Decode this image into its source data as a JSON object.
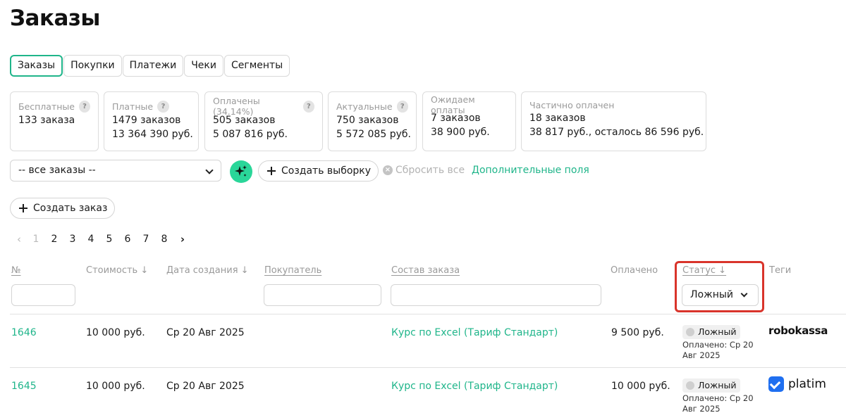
{
  "page": {
    "title": "Заказы"
  },
  "tabs": [
    {
      "label": "Заказы",
      "active": true
    },
    {
      "label": "Покупки"
    },
    {
      "label": "Платежи"
    },
    {
      "label": "Чеки"
    },
    {
      "label": "Сегменты"
    }
  ],
  "stats": [
    {
      "label": "Бесплатные",
      "help": "?",
      "line1": "133 заказа",
      "line2": ""
    },
    {
      "label": "Платные",
      "help": "?",
      "line1": "1479 заказов",
      "line2": "13 364 390 руб."
    },
    {
      "label": "Оплачены (34.14%)",
      "help": "?",
      "line1": "505 заказов",
      "line2": "5 087 816 руб."
    },
    {
      "label": "Актуальные",
      "help": "?",
      "line1": "750 заказов",
      "line2": "5 572 085 руб."
    },
    {
      "label": "Ожидаем оплаты",
      "line1": "7 заказов",
      "line2": "38 900 руб."
    },
    {
      "label": "Частично оплачен",
      "line1": "18 заказов",
      "line2": "38 817 руб., осталось 86 596 руб."
    }
  ],
  "filters": {
    "segment_select": "-- все заказы --",
    "create_selection": "Создать выборку",
    "reset_all": "Сбросить все",
    "extra_fields": "Дополнительные поля",
    "create_order": "Создать заказ"
  },
  "pagination": {
    "prev": "‹",
    "pages": [
      "1",
      "2",
      "3",
      "4",
      "5",
      "6",
      "7",
      "8"
    ],
    "current": "1",
    "next": "›"
  },
  "table": {
    "headers": {
      "number": "№",
      "cost": "Стоимость ↓",
      "created": "Дата создания ↓",
      "buyer": "Покупатель",
      "items": "Состав заказа",
      "paid": "Оплачено",
      "status": "Статус ↓",
      "tags": "Теги"
    },
    "status_filter_value": "Ложный",
    "rows": [
      {
        "number": "1646",
        "cost": "10 000 руб.",
        "created": "Ср 20 Авг 2025",
        "items": "Курс по Excel (Тариф Стандарт)",
        "paid": "9 500 руб.",
        "status": "Ложный",
        "paid_note": "Оплачено: Ср 20 Авг 2025",
        "tag": "robokassa",
        "tag_icon": "robokassa-logo"
      },
      {
        "number": "1645",
        "cost": "10 000 руб.",
        "created": "Ср 20 Авг 2025",
        "items": "Курс по Excel (Тариф Стандарт)",
        "paid": "10 000 руб.",
        "status": "Ложный",
        "paid_note": "Оплачено: Ср 20 Авг 2025",
        "tag": "platim",
        "tag_icon": "platim-check-icon"
      }
    ]
  },
  "colors": {
    "accent": "#1fb58a",
    "magic": "#2ad699",
    "highlight": "#d9342b",
    "platim": "#1f6ff0"
  }
}
